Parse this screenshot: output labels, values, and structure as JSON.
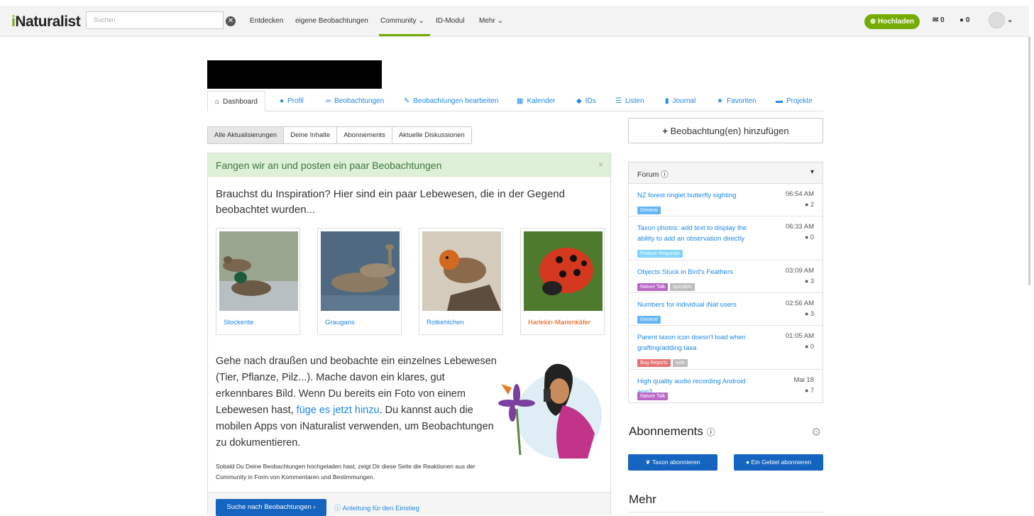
{
  "header": {
    "logo_prefix": "i",
    "logo_suffix": "Naturalist",
    "search_placeholder": "Suchen",
    "nav": [
      "Entdecken",
      "eigene Beobachtungen",
      "Community",
      "ID-Modul",
      "Mehr"
    ],
    "upload_label": "Hochladen",
    "messages_count": "0",
    "notifications_count": "0"
  },
  "tabs": [
    "Dashboard",
    "Profil",
    "Beobachtungen",
    "Beobachtungen bearbeiten",
    "Kalender",
    "IDs",
    "Listen",
    "Journal",
    "Favoriten",
    "Projekte"
  ],
  "filters": [
    "Alle Aktualisierungen",
    "Deine Inhalte",
    "Abonnements",
    "Aktuelle Diskussionen"
  ],
  "add_observation": "Beobachtung(en) hinzufügen",
  "welcome": {
    "title": "Fangen wir an und posten ein paar Beobachtungen",
    "close": "×",
    "intro": "Brauchst du Inspiration? Hier sind ein paar Lebewesen, die in der Gegend beobachtet wurden...",
    "species": [
      "Stockente",
      "Graugans",
      "Rotkehlchen",
      "Harlekin-Marienkäfer"
    ],
    "body_start": "Gehe nach draußen und beobachte ein einzelnes Lebewesen (Tier, Pflanze, Pilz...). Mache davon ein klares, gut erkennbares Bild. Wenn Du bereits ein Foto von einem Lebewesen hast, ",
    "body_link": "füge es jetzt hinzu",
    "body_end": ". Du kannst auch die mobilen Apps von iNaturalist verwenden, um Beobachtungen zu dokumentieren.",
    "small": "Sobald Du Deine Beobachtungen hochgeladen hast, zeigt Dir diese Seite die Reaktionen aus der Community in Form von Kommentaren und Bestimmungen.",
    "search_button": "Suche nach Beobachtungen",
    "guide_link": "Anleitung für den Einstieg"
  },
  "forum": {
    "title": "Forum",
    "items": [
      {
        "title": "NZ forest ringlet butterfly sighting",
        "time": "06:54 AM",
        "count": "2",
        "tags": [
          "General"
        ]
      },
      {
        "title": "Taxon photos: add text to display the ability to add an observation directly",
        "time": "06:33 AM",
        "count": "0",
        "tags": [
          "Feature Requests"
        ]
      },
      {
        "title": "Objects Stuck in Bird's Feathers",
        "time": "03:09 AM",
        "count": "3",
        "tags": [
          "Nature Talk",
          "question"
        ]
      },
      {
        "title": "Numbers for individual iNat users",
        "time": "02:56 AM",
        "count": "3",
        "tags": [
          "General"
        ]
      },
      {
        "title": "Parent taxon icon doesn't load when grafting/adding taxa",
        "time": "01:05 AM",
        "count": "0",
        "tags": [
          "Bug Reports",
          "web"
        ]
      },
      {
        "title": "High quality audio recording Android app?",
        "time": "Mai 18",
        "count": "7",
        "tags": [
          "Nature Talk"
        ]
      }
    ]
  },
  "subscriptions": {
    "title": "Abonnements",
    "taxon_button": "Taxon abonnieren",
    "place_button": "Ein Gebiet abonnieren"
  },
  "more_title": "Mehr",
  "colors": {
    "brand": "#74ac00",
    "link": "#1e88e5",
    "button": "#1565c0"
  }
}
